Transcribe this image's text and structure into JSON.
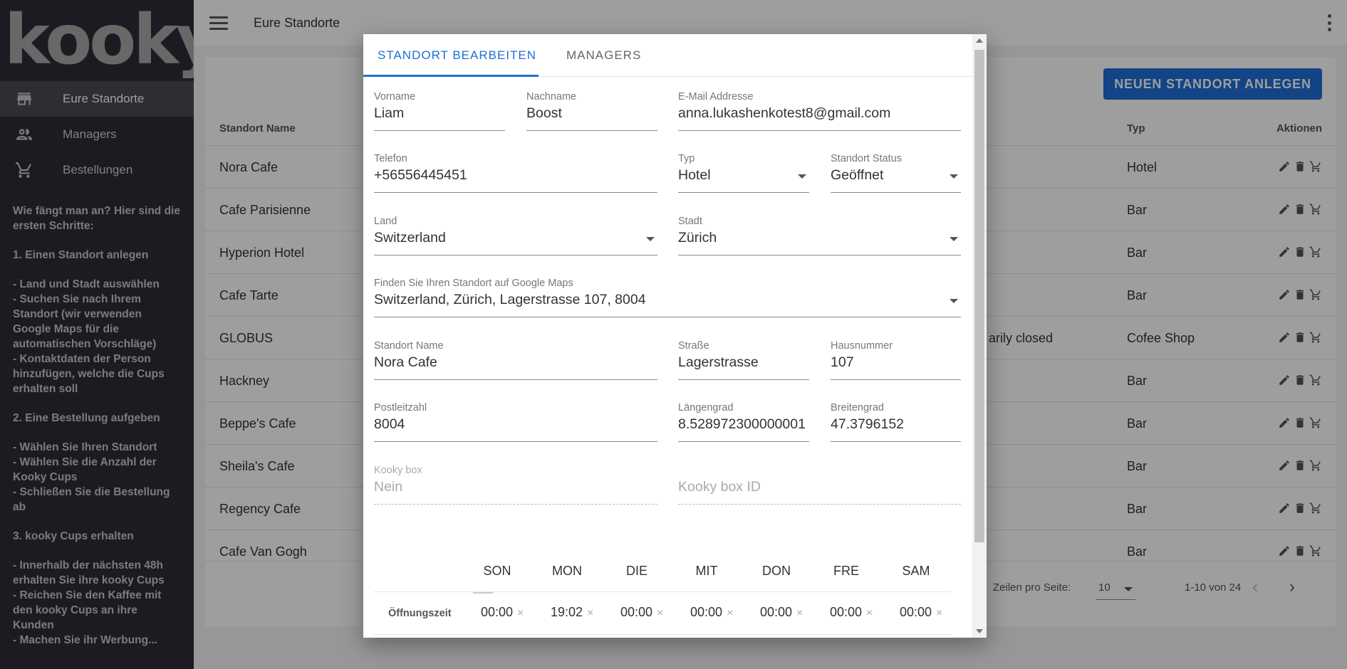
{
  "brand": {
    "logo_text": "kooky."
  },
  "sidebar": {
    "items": [
      {
        "label": "Eure Standorte",
        "icon": "store-icon",
        "active": true
      },
      {
        "label": "Managers",
        "icon": "people-icon",
        "active": false
      },
      {
        "label": "Bestellungen",
        "icon": "cart-icon",
        "active": false
      }
    ],
    "help": [
      "Wie fängt man an? Hier sind die ersten Schritte:",
      "1. Einen Standort anlegen",
      "- Land und Stadt auswählen\n- Suchen Sie nach Ihrem Standort (wir verwenden Google Maps für die automatischen Vorschläge)\n- Kontaktdaten der Person hinzufügen, welche die Cups erhalten soll",
      "2. Eine Bestellung aufgeben",
      "- Wählen Sie Ihren Standort\n- Wählen Sie die Anzahl der Kooky Cups\n- Schließen Sie die Bestellung ab",
      "3. kooky Cups erhalten",
      "- Innerhalb der nächsten 48h erhalten Sie ihre kooky Cups\n- Reichen Sie den Kaffee mit den kooky Cups an ihre Kunden\n- Machen Sie ihr Werbung..."
    ]
  },
  "topbar": {
    "title": "Eure Standorte"
  },
  "main": {
    "new_button": "NEUEN STANDORT ANLEGEN",
    "columns": {
      "name": "Standort Name",
      "typ": "Typ",
      "aktionen": "Aktionen"
    },
    "rows": [
      {
        "name": "Nora Cafe",
        "extra": "",
        "typ": "Hotel"
      },
      {
        "name": "Cafe Parisienne",
        "extra": "",
        "typ": "Bar"
      },
      {
        "name": "Hyperion Hotel",
        "extra": "",
        "typ": "Bar"
      },
      {
        "name": "Cafe Tarte",
        "extra": "",
        "typ": "Bar"
      },
      {
        "name": "GLOBUS",
        "extra": "arily closed",
        "typ": "Cofee Shop"
      },
      {
        "name": "Hackney",
        "extra": "",
        "typ": "Bar"
      },
      {
        "name": "Beppe's Cafe",
        "extra": "",
        "typ": "Bar"
      },
      {
        "name": "Sheila's Cafe",
        "extra": "",
        "typ": "Bar"
      },
      {
        "name": "Regency Cafe",
        "extra": "",
        "typ": "Bar"
      },
      {
        "name": "Cafe Van Gogh",
        "extra": "",
        "typ": "Bar"
      }
    ],
    "pager": {
      "rows_label": "Zeilen pro Seite:",
      "rows_value": "10",
      "range": "1-10 von 24"
    }
  },
  "dialog": {
    "tabs": [
      "STANDORT BEARBEITEN",
      "MANAGERS"
    ],
    "fields": {
      "vorname": {
        "label": "Vorname",
        "value": "Liam"
      },
      "nachname": {
        "label": "Nachname",
        "value": "Boost"
      },
      "email": {
        "label": "E-Mail Addresse",
        "value": "anna.lukashenkotest8@gmail.com"
      },
      "telefon": {
        "label": "Telefon",
        "value": "+56556445451"
      },
      "typ": {
        "label": "Typ",
        "value": "Hotel"
      },
      "status": {
        "label": "Standort Status",
        "value": "Geöffnet"
      },
      "land": {
        "label": "Land",
        "value": "Switzerland"
      },
      "stadt": {
        "label": "Stadt",
        "value": "Zürich"
      },
      "maps": {
        "label": "Finden Sie Ihren Standort auf Google Maps",
        "value": "Switzerland, Zürich, Lagerstrasse 107, 8004"
      },
      "standort_name": {
        "label": "Standort Name",
        "value": "Nora Cafe"
      },
      "strasse": {
        "label": "Straße",
        "value": "Lagerstrasse"
      },
      "hausnummer": {
        "label": "Hausnummer",
        "value": "107"
      },
      "plz": {
        "label": "Postleitzahl",
        "value": "8004"
      },
      "laengengrad": {
        "label": "Längengrad",
        "value": "8.528972300000001"
      },
      "breitengrad": {
        "label": "Breitengrad",
        "value": "47.3796152"
      },
      "kooky_box": {
        "label": "Kooky box",
        "value": "Nein"
      },
      "kooky_box_id": {
        "placeholder": "Kooky box ID"
      }
    },
    "hours": {
      "label": "Öffnungszeit",
      "days": [
        "SON",
        "MON",
        "DIE",
        "MIT",
        "DON",
        "FRE",
        "SAM"
      ],
      "times": [
        "00:00",
        "19:02",
        "00:00",
        "00:00",
        "00:00",
        "00:00",
        "00:00"
      ],
      "clear_symbol": "×"
    }
  },
  "colors": {
    "accent": "#1e6fd9",
    "sidebar_bg": "#2c2d36"
  }
}
